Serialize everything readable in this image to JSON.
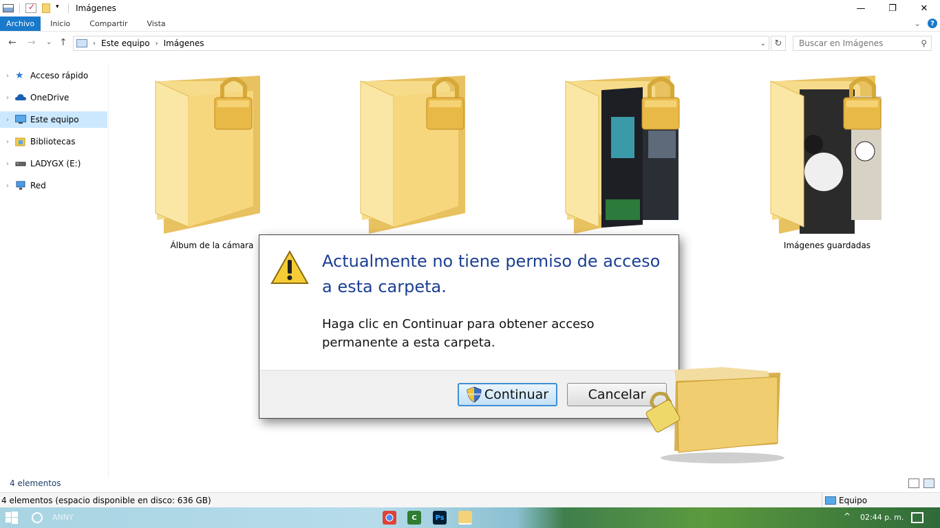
{
  "window": {
    "title": "Imágenes",
    "minimize": "—",
    "restore": "❐",
    "close": "✕"
  },
  "ribbon": {
    "tabs": [
      "Archivo",
      "Inicio",
      "Compartir",
      "Vista"
    ],
    "expand": "⌄",
    "help": "?"
  },
  "address": {
    "back": "←",
    "forward": "→",
    "recent": "⌄",
    "up": "↑",
    "crumbs": [
      "Este equipo",
      "Imágenes"
    ],
    "separator": "›",
    "dropdown": "⌄",
    "refresh": "↻"
  },
  "search": {
    "placeholder": "Buscar en Imágenes",
    "icon": "⚲"
  },
  "nav": {
    "expand": "›",
    "items": [
      "Acceso rápido",
      "OneDrive",
      "Este equipo",
      "Bibliotecas",
      "LADYGX (E:)",
      "Red"
    ]
  },
  "folders": [
    "Álbum de la cámara",
    "Imágenes guardadas"
  ],
  "status": {
    "count": "4 elementos",
    "details": "4 elementos (espacio disponible en disco: 636 GB)",
    "computer": "Equipo"
  },
  "dialog": {
    "heading_line1": "Actualmente no tiene permiso de acceso",
    "heading_line2": "a esta carpeta.",
    "body_line1": "Haga clic en Continuar para obtener acceso",
    "body_line2": "permanente a esta carpeta.",
    "continue_label": "Continuar",
    "cancel_label": "Cancelar"
  },
  "taskbar": {
    "user": "ANNY",
    "clock": "02:44 p. m.",
    "tray_arrow": "^",
    "apps": [
      "C",
      "Ps"
    ]
  },
  "colors": {
    "accent": "#1979ca",
    "folder": "#f3d27a",
    "lock": "#e0b84a",
    "heading": "#1c3f93"
  }
}
